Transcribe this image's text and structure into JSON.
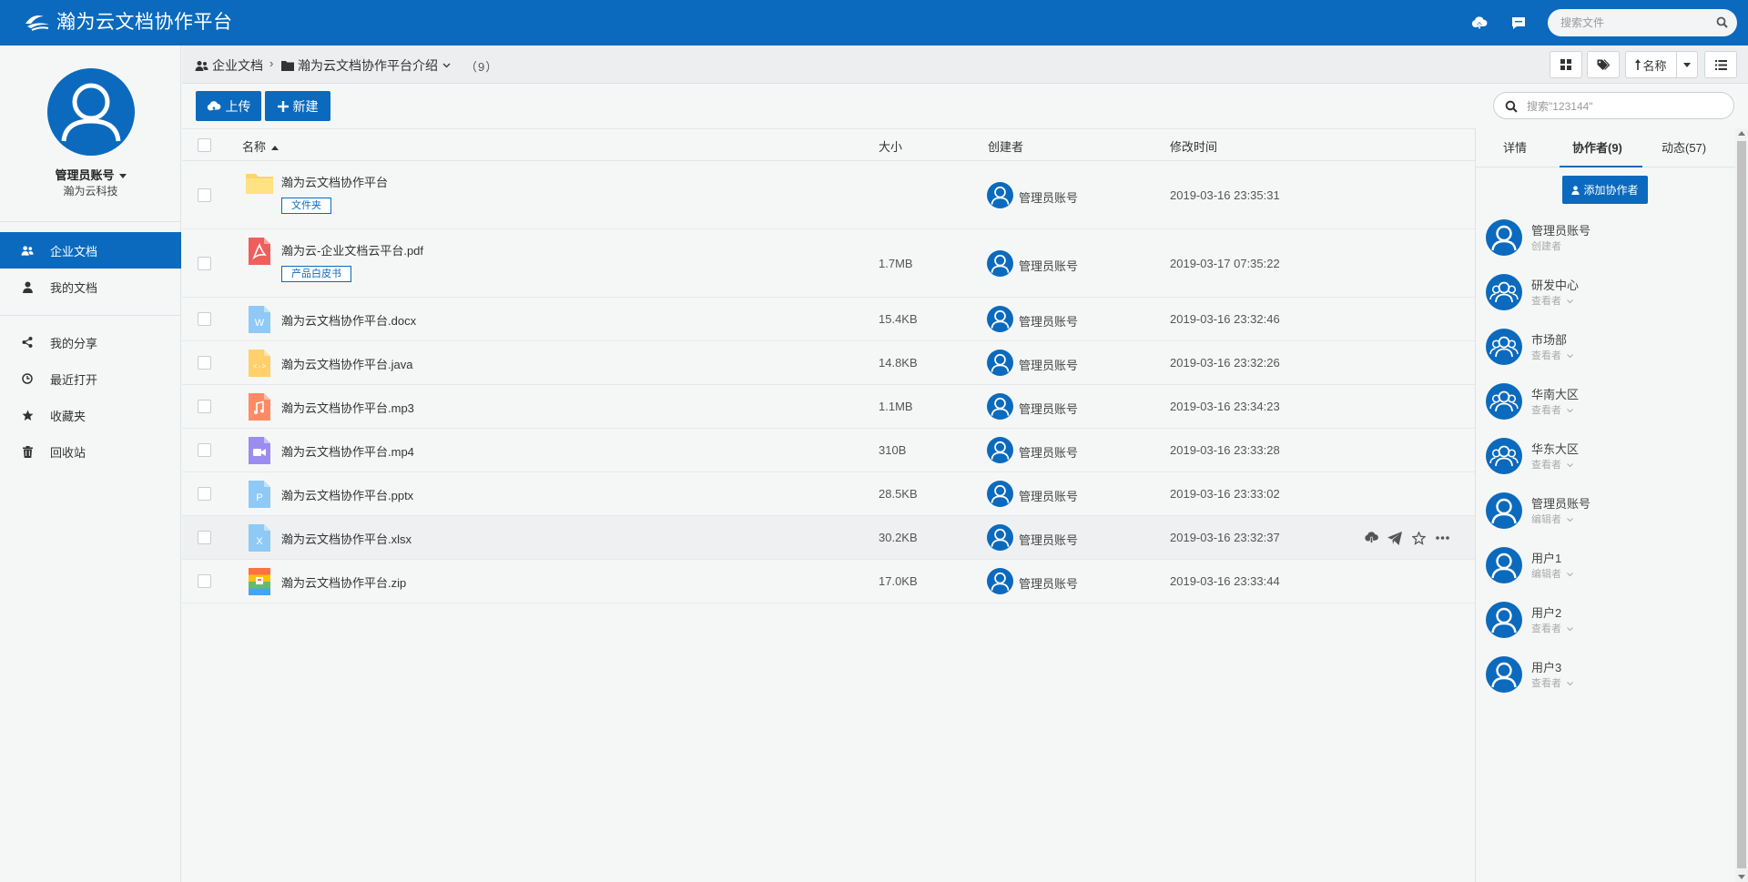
{
  "app": {
    "title": "瀚为云文档协作平台"
  },
  "header": {
    "search_placeholder": "搜索文件",
    "icons": [
      "cloud-upload-icon",
      "chat-icon",
      "search-icon"
    ]
  },
  "user": {
    "name": "管理员账号",
    "org": "瀚为云科技"
  },
  "sidebar": {
    "items": [
      {
        "label": "企业文档",
        "icon": "users-icon",
        "active": true
      },
      {
        "label": "我的文档",
        "icon": "user-icon",
        "active": false
      },
      {
        "label": "我的分享",
        "icon": "share-icon",
        "active": false
      },
      {
        "label": "最近打开",
        "icon": "clock-icon",
        "active": false
      },
      {
        "label": "收藏夹",
        "icon": "star-icon",
        "active": false
      },
      {
        "label": "回收站",
        "icon": "trash-icon",
        "active": false
      }
    ]
  },
  "breadcrumb": {
    "root": "企业文档",
    "current": "瀚为云文档协作平台介绍",
    "count": "（9）"
  },
  "toolbar": {
    "sort_label": "名称",
    "upload_label": "上传",
    "new_label": "新建",
    "search_placeholder": "搜索\"123144\""
  },
  "table": {
    "columns": {
      "name": "名称",
      "size": "大小",
      "creator": "创建者",
      "modified": "修改时间"
    },
    "rows": [
      {
        "name": "瀚为云文档协作平台",
        "type": "folder",
        "tag": "文件夹",
        "size": "",
        "creator": "管理员账号",
        "modified": "2019-03-16 23:35:31"
      },
      {
        "name": "瀚为云-企业文档云平台.pdf",
        "type": "pdf",
        "tag": "产品白皮书",
        "size": "1.7MB",
        "creator": "管理员账号",
        "modified": "2019-03-17 07:35:22"
      },
      {
        "name": "瀚为云文档协作平台.docx",
        "type": "docx",
        "tag": "",
        "size": "15.4KB",
        "creator": "管理员账号",
        "modified": "2019-03-16 23:32:46"
      },
      {
        "name": "瀚为云文档协作平台.java",
        "type": "java",
        "tag": "",
        "size": "14.8KB",
        "creator": "管理员账号",
        "modified": "2019-03-16 23:32:26"
      },
      {
        "name": "瀚为云文档协作平台.mp3",
        "type": "mp3",
        "tag": "",
        "size": "1.1MB",
        "creator": "管理员账号",
        "modified": "2019-03-16 23:34:23"
      },
      {
        "name": "瀚为云文档协作平台.mp4",
        "type": "mp4",
        "tag": "",
        "size": "310B",
        "creator": "管理员账号",
        "modified": "2019-03-16 23:33:28"
      },
      {
        "name": "瀚为云文档协作平台.pptx",
        "type": "pptx",
        "tag": "",
        "size": "28.5KB",
        "creator": "管理员账号",
        "modified": "2019-03-16 23:33:02"
      },
      {
        "name": "瀚为云文档协作平台.xlsx",
        "type": "xlsx",
        "tag": "",
        "size": "30.2KB",
        "creator": "管理员账号",
        "modified": "2019-03-16 23:32:37"
      },
      {
        "name": "瀚为云文档协作平台.zip",
        "type": "zip",
        "tag": "",
        "size": "17.0KB",
        "creator": "管理员账号",
        "modified": "2019-03-16 23:33:44"
      }
    ]
  },
  "panel": {
    "tabs": [
      "详情",
      "协作者(9)",
      "动态(57)"
    ],
    "active_tab": "协作者(9)",
    "add_label": "添加协作者",
    "collaborators": [
      {
        "name": "管理员账号",
        "role": "创建者",
        "kind": "user"
      },
      {
        "name": "研发中心",
        "role": "查看者",
        "kind": "group"
      },
      {
        "name": "市场部",
        "role": "查看者",
        "kind": "group"
      },
      {
        "name": "华南大区",
        "role": "查看者",
        "kind": "group"
      },
      {
        "name": "华东大区",
        "role": "查看者",
        "kind": "group"
      },
      {
        "name": "管理员账号",
        "role": "编辑者",
        "kind": "user"
      },
      {
        "name": "用户1",
        "role": "编辑者",
        "kind": "user"
      },
      {
        "name": "用户2",
        "role": "查看者",
        "kind": "user"
      },
      {
        "name": "用户3",
        "role": "查看者",
        "kind": "user"
      }
    ]
  },
  "colors": {
    "brand": "#0b6abd",
    "background": "#f5f7f7",
    "border": "#dde2e6"
  }
}
